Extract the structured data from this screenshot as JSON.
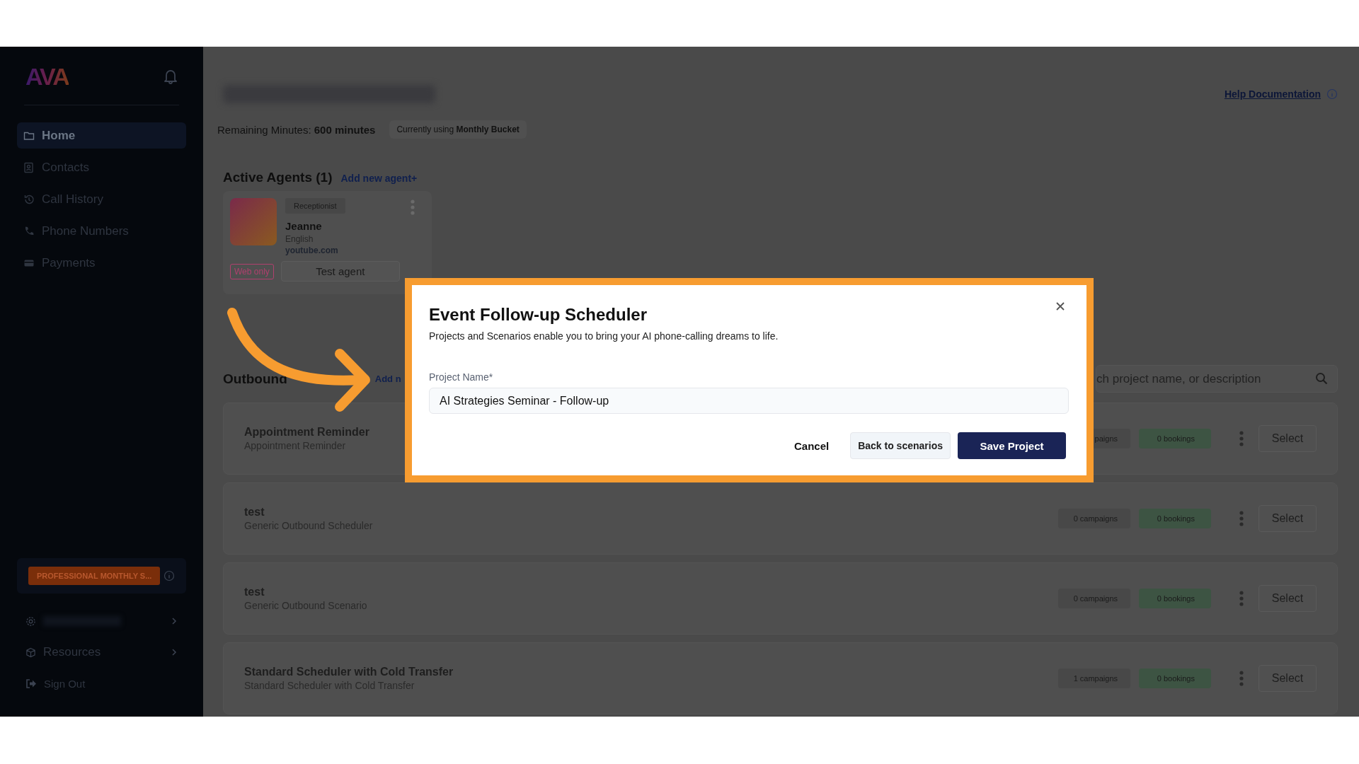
{
  "sidebar": {
    "logo": "AVA",
    "nav": [
      {
        "label": "Home",
        "selected": true
      },
      {
        "label": "Contacts",
        "selected": false
      },
      {
        "label": "Call History",
        "selected": false
      },
      {
        "label": "Phone Numbers",
        "selected": false
      },
      {
        "label": "Payments",
        "selected": false
      }
    ],
    "plan_badge": "PROFESSIONAL MONTHLY S...",
    "footer_items": [
      {
        "label": "Resources",
        "kind": "menu"
      },
      {
        "label": "Sign Out",
        "kind": "action"
      }
    ]
  },
  "header": {
    "help_link": "Help Documentation",
    "remaining": "Remaining Minutes: **600 minutes**",
    "bucket_chip": "Currently using **Monthly Bucket**"
  },
  "agents": {
    "heading": "Active Agents (1)",
    "add_link": "Add new agent+",
    "cards": [
      {
        "role": "Receptionist",
        "name": "Jeanne",
        "language": "English",
        "domain": "youtube.com",
        "tag": "Web only",
        "test_button": "Test agent"
      }
    ]
  },
  "projects": {
    "heading": "Outbound",
    "add_link": "Add n",
    "search_placeholder": "ch project name, or description",
    "rows": [
      {
        "title": "Appointment Reminder",
        "subtitle": "Appointment Reminder",
        "campaigns": "paigns",
        "bookings": "0 bookings",
        "select": "Select"
      },
      {
        "title": "test",
        "subtitle": "Generic Outbound Scheduler",
        "campaigns": "0 campaigns",
        "bookings": "0 bookings",
        "select": "Select"
      },
      {
        "title": "test",
        "subtitle": "Generic Outbound Scenario",
        "campaigns": "0 campaigns",
        "bookings": "0 bookings",
        "select": "Select"
      },
      {
        "title": "Standard Scheduler with Cold Transfer",
        "subtitle": "Standard Scheduler with Cold Transfer",
        "campaigns": "1 campaigns",
        "bookings": "0 bookings",
        "select": "Select"
      }
    ]
  },
  "modal": {
    "title": "Event Follow-up Scheduler",
    "subtitle": "Projects and Scenarios enable you to bring your AI phone-calling dreams to life.",
    "field_label": "Project Name*",
    "field_value": "AI Strategies Seminar - Follow-up",
    "cancel": "Cancel",
    "back": "Back to scenarios",
    "save": "Save Project"
  }
}
